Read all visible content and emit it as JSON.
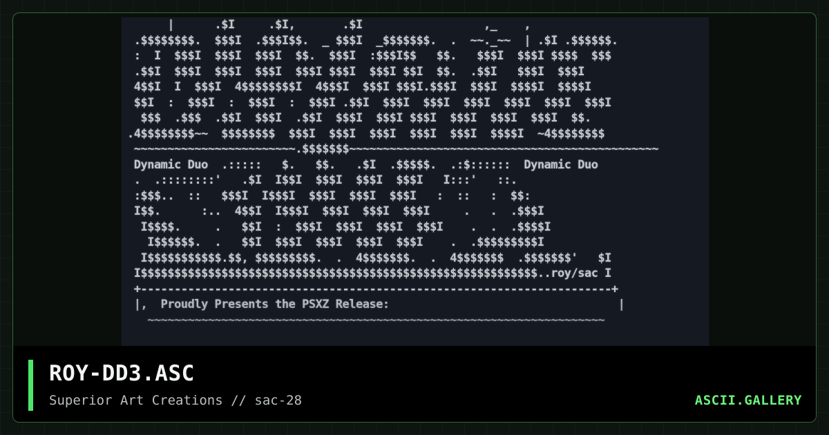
{
  "artwork": {
    "lines": [
      "      |      .$I     .$I,       .$I                  ,_    ,",
      " .$$$$$$$$.  $$$I  .$$$I$$.  _ $$$I  _$$$$$$$.  .  ~~._~~  | .$I .$$$$$$.",
      " :  I  $$$I  $$$I  $$$I  $$.  $$$I  :$$$I$$   $$.   $$$I  $$$I $$$$  $$$",
      " .$$I  $$$I  $$$I  $$$I  $$$I $$$I  $$$I $$I  $$.  .$$I   $$$I  $$$I",
      " 4$$I  I  $$$I  4$$$$$$$$I  4$$$I  $$$I $$$I.$$$I  $$$I  $$$$I  $$$$I",
      " $$I  :  $$$I  :  $$$I  :  $$$I .$$I  $$$I  $$$I  $$$I  $$$I  $$$I  $$$I",
      "  $$$  .$$$  .$$I  $$$I  .$$I  $$$I  $$$I $$$I  $$$I  $$$I  $$$I  $$.",
      ".4$$$$$$$$~~  $$$$$$$$  $$$I  $$$I  $$$I  $$$I  $$$I  $$$$I  ~4$$$$$$$$",
      " ~~~~~~~~~~~~~~~~~~~~~~~~.$$$$$$$~~~~~~~~~~~~~~~~~~~~~~~~~~~~~~~~~~~~~~~~~~~~~~",
      " Dynamic Duo  .:::::   $.   $$.   .$I  .$$$$$.  .:$::::::  Dynamic Duo",
      " .  .::::::::'   .$I  I$$I  $$$I  $$$I  $$$I   I:::'   ::.",
      " :$$$..  ::   $$$I  I$$$I  $$$I  $$$I  $$$I   :  ::   :  $$:",
      " I$$.      :..  4$$I  I$$$I  $$$I  $$$I  $$$I     .   .  .$$$I",
      "  I$$$$.     .   $$I  :  $$$I  $$$I  $$$I  $$$I    .  .  .$$$$I",
      "   I$$$$$$.  .   $$I  $$$I  $$$I  $$$I  $$$I    .  .$$$$$$$$$I",
      "  I$$$$$$$$$$$.$$, $$$$$$$$$.  .  4$$$$$$$.  .  4$$$$$$$  .$$$$$$$'   $I",
      " I$$$$$$$$$$$$$$$$$$$$$$$$$$$$$$$$$$$$$$$$$$$$$$$$$$$$$$$$$$$..roy/sac I",
      " +----------------------------------------------------------------------+",
      " |,  Proudly Presents the PSXZ Release:                                  |",
      "   ~~~~~~~~~~~~~~~~~~~~~~~~~~~~~~~~~~~~~~~~~~~~~~~~~~~~~~~~~~~~~~~~~~~~"
    ]
  },
  "footer": {
    "title": "ROY-DD3.ASC",
    "subtitle": "Superior Art Creations // sac-28",
    "brand": "ASCII.GALLERY"
  },
  "colors": {
    "accent": "#4ee66a",
    "brand": "#6df07c",
    "border": "#2f6b35",
    "art_background": "#151a22"
  }
}
